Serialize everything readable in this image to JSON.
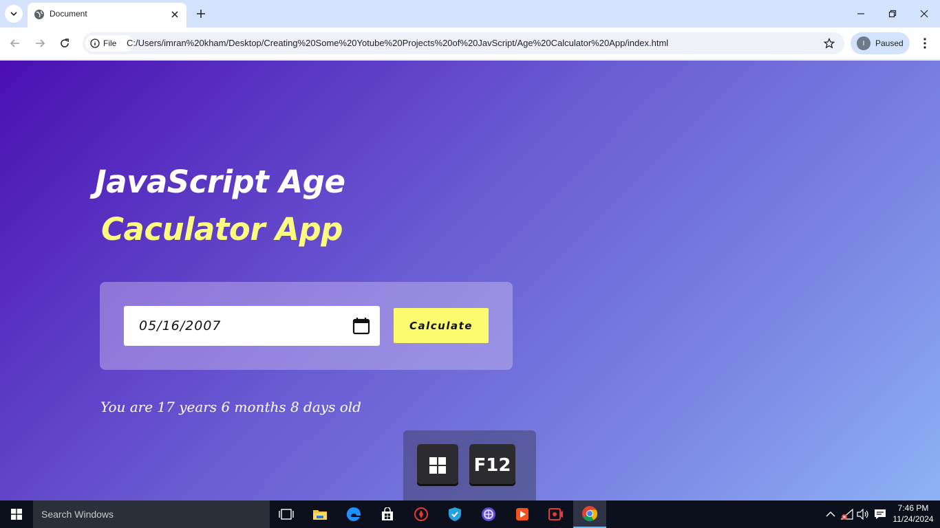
{
  "browser": {
    "tab": {
      "title": "Document"
    },
    "address_bar": {
      "site_label": "File",
      "url": "C:/Users/imran%20kham/Desktop/Creating%20Some%20Yotube%20Projects%20of%20JavScript/Age%20Calculator%20App/index.html"
    },
    "profile": {
      "initial": "I",
      "status": "Paused"
    }
  },
  "app": {
    "title_line1": "JavaScript Age",
    "title_line2": "Caculator App",
    "date_value": "05/16/2007",
    "calculate_label": "Calculate",
    "result_text": "You are 17 years 6 months 8 days old",
    "colors": {
      "title_white": "#ffffff",
      "title_yellow": "#fdfb7f",
      "button": "#fdfb6f",
      "gradient_start": "#4a0fb3",
      "gradient_end": "#8eb2f5"
    }
  },
  "key_overlay": {
    "keys": [
      "windows-key",
      "F12"
    ]
  },
  "taskbar": {
    "search_placeholder": "Search Windows",
    "apps": [
      "task-view-icon",
      "file-explorer-icon",
      "edge-icon",
      "store-icon",
      "game-app-icon",
      "vpn-shield-icon",
      "settings-app-icon",
      "video-player-icon",
      "screen-recorder-icon",
      "chrome-icon"
    ],
    "clock": {
      "time": "7:46 PM",
      "date": "11/24/2024"
    }
  }
}
